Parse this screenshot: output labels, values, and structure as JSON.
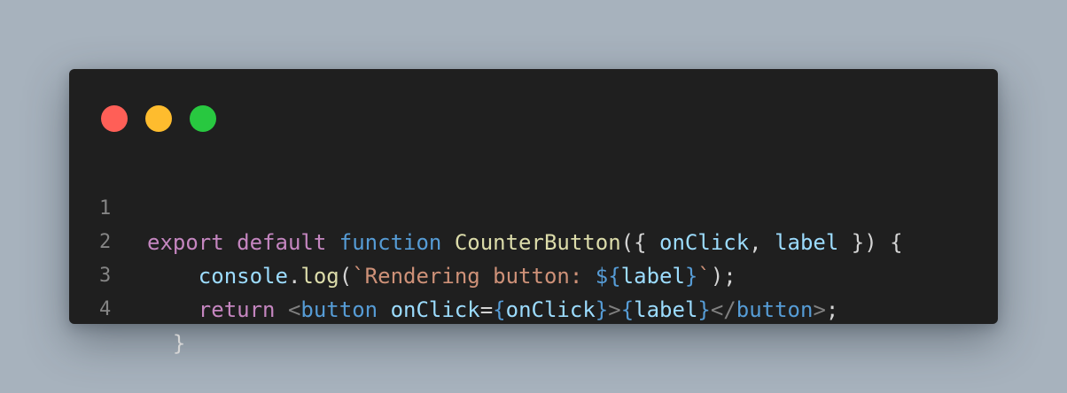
{
  "window": {
    "dots": [
      {
        "name": "close",
        "color": "#ff5f57"
      },
      {
        "name": "minimize",
        "color": "#febc2e"
      },
      {
        "name": "maximize",
        "color": "#28c840"
      }
    ]
  },
  "code": {
    "lines": [
      {
        "number": "1"
      },
      {
        "number": "2"
      },
      {
        "number": "3"
      },
      {
        "number": "4"
      }
    ],
    "tokens": {
      "l1_export": "export",
      "l1_default": "default",
      "l1_function": "function",
      "l1_name": "CounterButton",
      "l1_open": "({ ",
      "l1_p1": "onClick",
      "l1_comma": ", ",
      "l1_p2": "label",
      "l1_close": " }) {",
      "l2_console": "console",
      "l2_dot": ".",
      "l2_log": "log",
      "l2_paren": "(",
      "l2_str": "`Rendering button: ",
      "l2_interp_open": "${",
      "l2_var": "label",
      "l2_interp_close": "}",
      "l2_tick": "`",
      "l2_end": ");",
      "l3_return": "return",
      "l3_lt": "<",
      "l3_tag": "button",
      "l3_attr": "onClick",
      "l3_eq": "=",
      "l3_brace_open": "{",
      "l3_val": "onClick",
      "l3_brace_close": "}",
      "l3_gt": ">",
      "l3_brace2_open": "{",
      "l3_child": "label",
      "l3_brace2_close": "}",
      "l3_close_lt": "</",
      "l3_close_tag": "button",
      "l3_close_gt": ">",
      "l3_semi": ";",
      "l4_brace": "}"
    }
  }
}
